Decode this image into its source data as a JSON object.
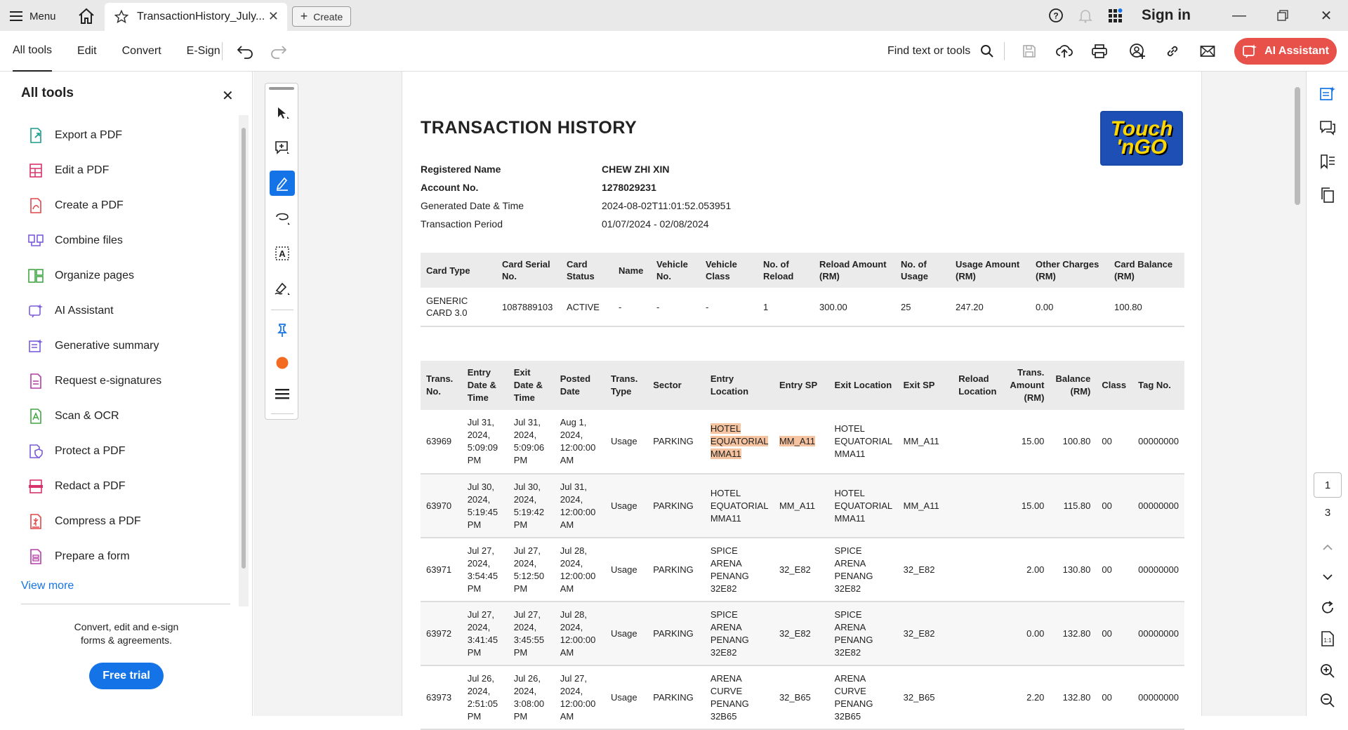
{
  "titlebar": {
    "menu_label": "Menu",
    "tab_title": "TransactionHistory_July...",
    "create_label": "Create",
    "signin_label": "Sign in"
  },
  "toolbar": {
    "tabs": [
      "All tools",
      "Edit",
      "Convert",
      "E-Sign"
    ],
    "find_label": "Find text or tools",
    "ai_label": "AI Assistant",
    "accent_color": "#e8504a"
  },
  "left_panel": {
    "title": "All tools",
    "items": [
      {
        "label": "Export a PDF",
        "icon": "export-pdf-icon"
      },
      {
        "label": "Edit a PDF",
        "icon": "edit-pdf-icon"
      },
      {
        "label": "Create a PDF",
        "icon": "create-pdf-icon"
      },
      {
        "label": "Combine files",
        "icon": "combine-files-icon"
      },
      {
        "label": "Organize pages",
        "icon": "organize-pages-icon"
      },
      {
        "label": "AI Assistant",
        "icon": "ai-assistant-icon"
      },
      {
        "label": "Generative summary",
        "icon": "generative-summary-icon"
      },
      {
        "label": "Request e-signatures",
        "icon": "e-signature-icon"
      },
      {
        "label": "Scan & OCR",
        "icon": "scan-ocr-icon"
      },
      {
        "label": "Protect a PDF",
        "icon": "protect-pdf-icon"
      },
      {
        "label": "Redact a PDF",
        "icon": "redact-pdf-icon"
      },
      {
        "label": "Compress a PDF",
        "icon": "compress-pdf-icon"
      },
      {
        "label": "Prepare a form",
        "icon": "prepare-form-icon"
      }
    ],
    "view_more": "View more",
    "promo_line1": "Convert, edit and e-sign",
    "promo_line2": "forms & agreements.",
    "trial_label": "Free trial"
  },
  "document": {
    "title": "TRANSACTION HISTORY",
    "logo_text_1": "Touch",
    "logo_text_2": "'nGO",
    "info": [
      {
        "key": "Registered Name",
        "value": "CHEW ZHI XIN",
        "bold": true
      },
      {
        "key": "Account No.",
        "value": "1278029231",
        "bold": true
      },
      {
        "key": "Generated Date & Time",
        "value": "2024-08-02T11:01:52.053951",
        "bold": false
      },
      {
        "key": "Transaction Period",
        "value": "01/07/2024 - 02/08/2024",
        "bold": false
      }
    ],
    "card_table": {
      "headers": [
        "Card Type",
        "Card Serial No.",
        "Card Status",
        "Name",
        "Vehicle No.",
        "Vehicle Class",
        "No. of Reload",
        "Reload Amount (RM)",
        "No. of Usage",
        "Usage Amount (RM)",
        "Other Charges (RM)",
        "Card Balance (RM)"
      ],
      "row": [
        "GENERIC CARD 3.0",
        "1087889103",
        "ACTIVE",
        "-",
        "-",
        "-",
        "1",
        "300.00",
        "25",
        "247.20",
        "0.00",
        "100.80"
      ]
    },
    "trans_table": {
      "headers": [
        "Trans. No.",
        "Entry Date & Time",
        "Exit Date & Time",
        "Posted Date",
        "Trans. Type",
        "Sector",
        "Entry Location",
        "Entry SP",
        "Exit Location",
        "Exit SP",
        "Reload Location",
        "Trans. Amount (RM)",
        "Balance (RM)",
        "Class",
        "Tag No."
      ],
      "rows": [
        [
          "63969",
          "Jul 31, 2024, 5:09:09 PM",
          "Jul 31, 2024, 5:09:06 PM",
          "Aug 1, 2024, 12:00:00 AM",
          "Usage",
          "PARKING",
          "HOTEL EQUATORIAL MMA11",
          "MM_A11",
          "HOTEL EQUATORIAL MMA11",
          "MM_A11",
          "",
          "15.00",
          "100.80",
          "00",
          "00000000"
        ],
        [
          "63970",
          "Jul 30, 2024, 5:19:45 PM",
          "Jul 30, 2024, 5:19:42 PM",
          "Jul 31, 2024, 12:00:00 AM",
          "Usage",
          "PARKING",
          "HOTEL EQUATORIAL MMA11",
          "MM_A11",
          "HOTEL EQUATORIAL MMA11",
          "MM_A11",
          "",
          "15.00",
          "115.80",
          "00",
          "00000000"
        ],
        [
          "63971",
          "Jul 27, 2024, 3:54:45 PM",
          "Jul 27, 2024, 5:12:50 PM",
          "Jul 28, 2024, 12:00:00 AM",
          "Usage",
          "PARKING",
          "SPICE ARENA PENANG 32E82",
          "32_E82",
          "SPICE ARENA PENANG 32E82",
          "32_E82",
          "",
          "2.00",
          "130.80",
          "00",
          "00000000"
        ],
        [
          "63972",
          "Jul 27, 2024, 3:41:45 PM",
          "Jul 27, 2024, 3:45:55 PM",
          "Jul 28, 2024, 12:00:00 AM",
          "Usage",
          "PARKING",
          "SPICE ARENA PENANG 32E82",
          "32_E82",
          "SPICE ARENA PENANG 32E82",
          "32_E82",
          "",
          "0.00",
          "132.80",
          "00",
          "00000000"
        ],
        [
          "63973",
          "Jul 26, 2024, 2:51:05 PM",
          "Jul 26, 2024, 3:08:00 PM",
          "Jul 27, 2024, 12:00:00 AM",
          "Usage",
          "PARKING",
          "ARENA CURVE PENANG 32B65",
          "32_B65",
          "ARENA CURVE PENANG 32B65",
          "32_B65",
          "",
          "2.20",
          "132.80",
          "00",
          "00000000"
        ]
      ]
    }
  },
  "page_nav": {
    "current": "1",
    "total": "3"
  }
}
